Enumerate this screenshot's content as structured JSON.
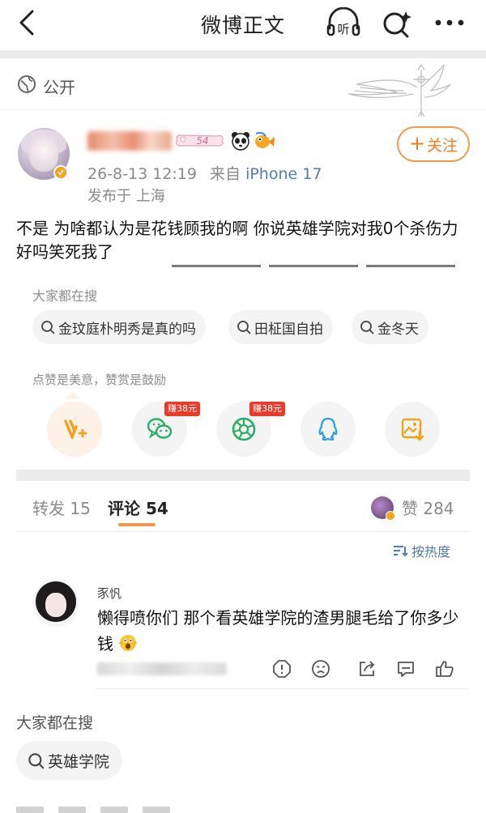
{
  "nav": {
    "title": "微博正文"
  },
  "visibility": {
    "label": "公开"
  },
  "author": {
    "name_redacted": "",
    "level": "54",
    "time": "26-8-13 12:19",
    "from_label": "来自",
    "device": "iPhone 17",
    "location": "发布于 上海",
    "follow_label": "关注"
  },
  "post": {
    "text": "不是 为啥都认为是花钱顾我的啊 你说英雄学院对我0个杀伤力好吗笑死我了"
  },
  "trending": {
    "heading": "大家都在搜",
    "chips": [
      "金玟庭朴明秀是真的吗",
      "田柾国自拍",
      "金冬天"
    ]
  },
  "reward": {
    "heading": "点赞是美意，赞赏是鼓励"
  },
  "share": {
    "items": [
      {
        "icon": "reward-v-icon"
      },
      {
        "icon": "wechat-icon",
        "badge": "赚38元"
      },
      {
        "icon": "moments-icon",
        "badge": "赚38元"
      },
      {
        "icon": "qq-icon"
      },
      {
        "icon": "save-image-icon"
      }
    ]
  },
  "tabs": {
    "repost": "转发 15",
    "comment": "评论 54",
    "likes": "赞 284"
  },
  "sort": {
    "label": "按热度"
  },
  "comment": {
    "user": "豕忛",
    "text": "懒得喷你们 那个看英雄学院的渣男腿毛给了你多少钱"
  },
  "bottom_trending": {
    "heading": "大家都在搜",
    "chip": "英雄学院"
  },
  "colors": {
    "accent": "#f07b1f",
    "link": "#507daf",
    "earn_badge": "#e93b2b",
    "wechat": "#2aae67",
    "qq": "#2c9ff0",
    "save": "#f0a21b"
  }
}
